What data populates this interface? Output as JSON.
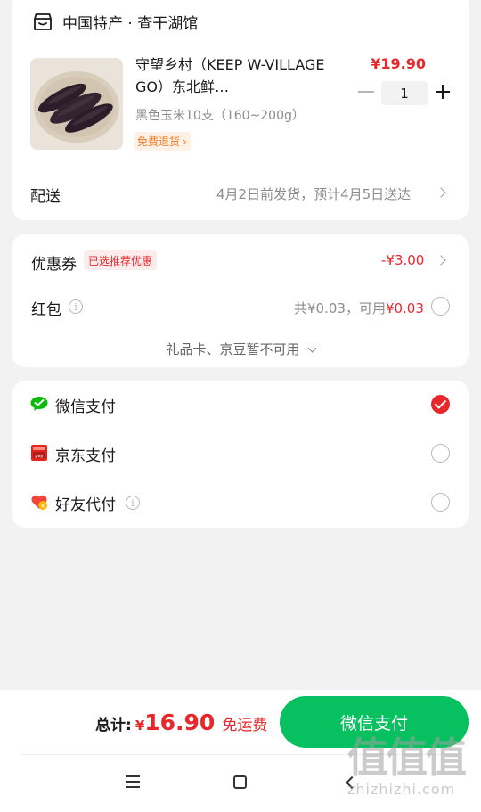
{
  "store": {
    "name": "中国特产 · 查干湖馆",
    "product": {
      "title": "守望乡村（KEEP W-VILLAGE GO）东北鲜…",
      "spec": "黑色玉米10支（160~200g）",
      "free_return": "免费退货",
      "price": "¥19.90",
      "quantity": "1"
    },
    "delivery_label": "配送",
    "delivery_value": "4月2日前发货，预计4月5日送达"
  },
  "discount": {
    "coupon_label": "优惠券",
    "coupon_tag": "已选推荐优惠",
    "coupon_value": "-¥3.00",
    "redpacket_label": "红包",
    "redpacket_total": "共¥0.03，可用",
    "redpacket_avail": "¥0.03",
    "more": "礼品卡、京豆暂不可用"
  },
  "payment": {
    "options": [
      {
        "label": "微信支付",
        "icon": "wechat-pay-icon",
        "selected": true
      },
      {
        "label": "京东支付",
        "icon": "jd-pay-icon",
        "selected": false
      },
      {
        "label": "好友代付",
        "icon": "friend-pay-icon",
        "selected": false
      }
    ]
  },
  "bottom": {
    "total_label": "总计:",
    "currency": "¥",
    "total_amount": "16.90",
    "free_shipping": "免运费",
    "pay_button": "微信支付"
  },
  "watermark": {
    "big": "值值值",
    "small": "zhizhizhi.com"
  },
  "colors": {
    "accent_red": "#e8272c",
    "wechat_green": "#07c160",
    "orange": "#f07a1e"
  }
}
